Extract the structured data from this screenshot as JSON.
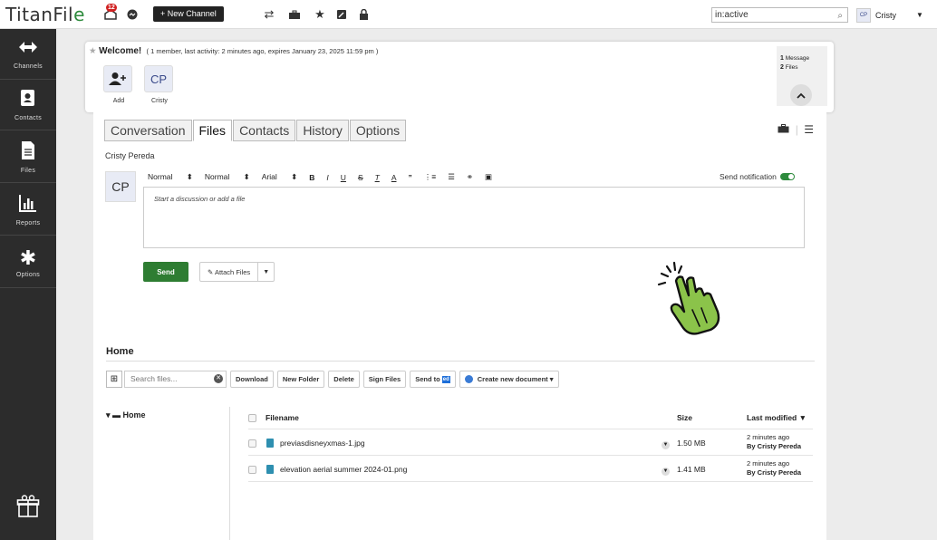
{
  "app": {
    "logo": "TitanFile",
    "logo_main": "TitanFil",
    "logo_accent": "e"
  },
  "topbar": {
    "notification_count": "12",
    "new_channel_label": "+ New Channel",
    "search_value": "in:active",
    "user_initials": "CP",
    "user_name": "Cristy"
  },
  "sidebar": {
    "items": [
      {
        "label": "Channels",
        "icon": "arrows-icon"
      },
      {
        "label": "Contacts",
        "icon": "contacts-icon"
      },
      {
        "label": "Files",
        "icon": "file-icon"
      },
      {
        "label": "Reports",
        "icon": "chart-icon"
      },
      {
        "label": "Options",
        "icon": "gear-icon"
      }
    ]
  },
  "welcome": {
    "title": "Welcome!",
    "meta": "( 1 member, last activity: 2 minutes ago, expires January 23, 2025 11:59 pm )",
    "members": [
      {
        "label": "Add",
        "icon": "add-user-icon"
      },
      {
        "label": "Cristy",
        "initials": "CP"
      }
    ],
    "summary": {
      "messages_count": "1",
      "messages_label": "Message",
      "files_count": "2",
      "files_label": "Files"
    }
  },
  "tabs": [
    "Conversation",
    "Files",
    "Contacts",
    "History",
    "Options"
  ],
  "active_tab": "Files",
  "composer": {
    "author": "Cristy Pereda",
    "avatar_initials": "CP",
    "toolbar": {
      "style1": "Normal",
      "style2": "Normal",
      "font": "Arial"
    },
    "send_notification_label": "Send notification",
    "placeholder": "Start a discussion or add a file",
    "send_label": "Send",
    "attach_label": "Attach Files"
  },
  "files": {
    "heading": "Home",
    "search_placeholder": "Search files...",
    "buttons": {
      "download": "Download",
      "new_folder": "New Folder",
      "delete": "Delete",
      "sign_files": "Sign Files",
      "send_to": "Send to",
      "send_to_badge": "ed",
      "create_doc": "Create new document"
    },
    "tree_root": "Home",
    "columns": {
      "filename": "Filename",
      "size": "Size",
      "modified": "Last modified ▼"
    },
    "rows": [
      {
        "name": "previasdisneyxmas-1.jpg",
        "size": "1.50 MB",
        "modified_time": "2 minutes ago",
        "modified_by": "By Cristy Pereda"
      },
      {
        "name": "elevation aerial summer 2024-01.png",
        "size": "1.41 MB",
        "modified_time": "2 minutes ago",
        "modified_by": "By Cristy Pereda"
      }
    ]
  },
  "colors": {
    "accent_green": "#2e7d32",
    "sidebar": "#2c2c2c",
    "hand": "#8bc34a"
  }
}
